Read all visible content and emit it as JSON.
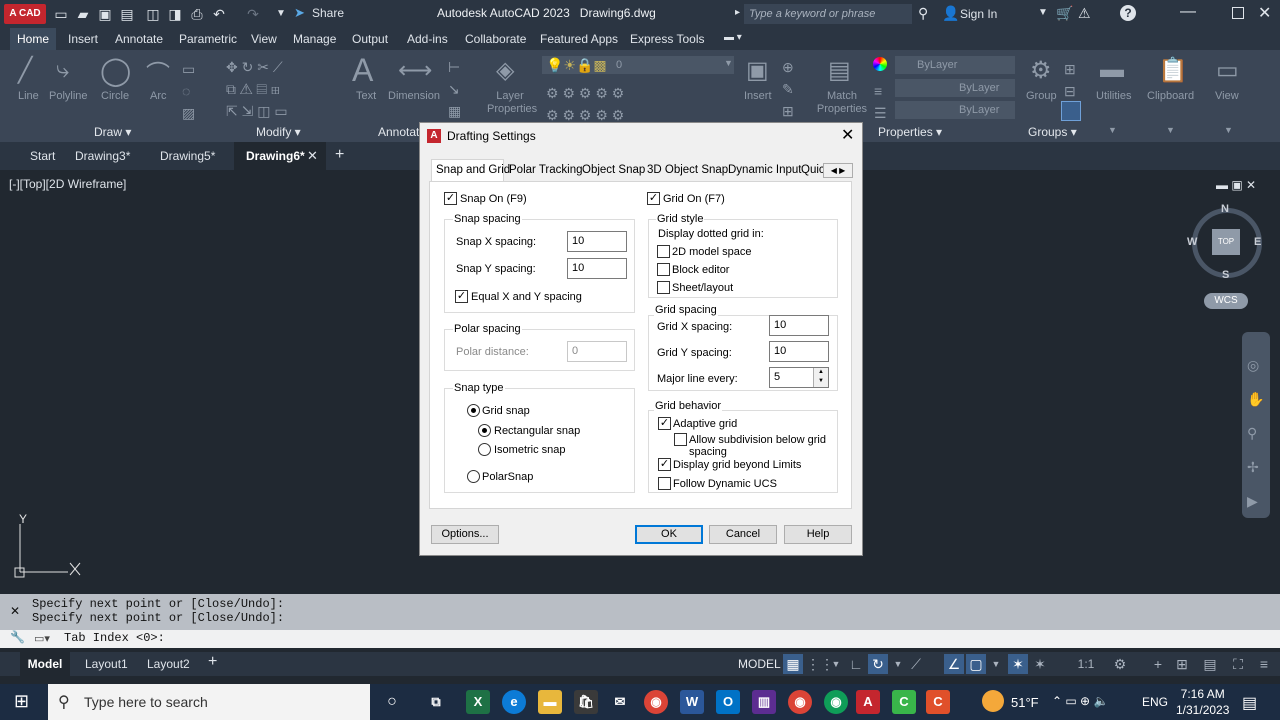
{
  "app": {
    "logo": "A CAD",
    "title": "Autodesk AutoCAD 2023",
    "filename": "Drawing6.dwg",
    "share_label": "Share",
    "search_placeholder": "Type a keyword or phrase",
    "signin_label": "Sign In"
  },
  "ribbon": {
    "tabs": [
      "Home",
      "Insert",
      "Annotate",
      "Parametric",
      "View",
      "Manage",
      "Output",
      "Add-ins",
      "Collaborate",
      "Featured Apps",
      "Express Tools"
    ],
    "draw_tools": [
      "Line",
      "Polyline",
      "Circle",
      "Arc"
    ],
    "text_tools": [
      "Text",
      "Dimension"
    ],
    "layer_props": "Layer Properties",
    "layer_value": "0",
    "insert": "Insert",
    "match_props": "Match Properties",
    "bylayer": [
      "ByLayer",
      "ByLayer",
      "ByLayer"
    ],
    "group": "Group",
    "utilities": "Utilities",
    "clipboard": "Clipboard",
    "view": "View",
    "panels": [
      "Draw",
      "Modify",
      "Annotat",
      "Properties",
      "Groups"
    ]
  },
  "doctabs": [
    "Start",
    "Drawing3*",
    "Drawing5*",
    "Drawing6*"
  ],
  "viewport": {
    "label": "[-][Top][2D Wireframe]",
    "ucs_y": "Y",
    "viewcube": {
      "n": "N",
      "s": "S",
      "e": "E",
      "w": "W",
      "top": "TOP"
    },
    "wcs": "WCS"
  },
  "dialog": {
    "title": "Drafting Settings",
    "tabs": [
      "Snap and Grid",
      "Polar Tracking",
      "Object Snap",
      "3D Object Snap",
      "Dynamic Input",
      "Quic"
    ],
    "snap_on": "Snap On (F9)",
    "snap_spacing": {
      "title": "Snap spacing",
      "x_label": "Snap X spacing:",
      "x_value": "10",
      "y_label": "Snap Y spacing:",
      "y_value": "10",
      "equal": "Equal X and Y spacing"
    },
    "polar_spacing": {
      "title": "Polar spacing",
      "label": "Polar distance:",
      "value": "0"
    },
    "snap_type": {
      "title": "Snap type",
      "grid": "Grid snap",
      "rect": "Rectangular snap",
      "iso": "Isometric snap",
      "polar": "PolarSnap"
    },
    "grid_on": "Grid On (F7)",
    "grid_style": {
      "title": "Grid style",
      "subtitle": "Display dotted grid in:",
      "model": "2D model space",
      "block": "Block editor",
      "sheet": "Sheet/layout"
    },
    "grid_spacing": {
      "title": "Grid spacing",
      "x_label": "Grid X spacing:",
      "x_value": "10",
      "y_label": "Grid Y spacing:",
      "y_value": "10",
      "major_label": "Major line every:",
      "major_value": "5"
    },
    "grid_behavior": {
      "title": "Grid behavior",
      "adaptive": "Adaptive grid",
      "subdiv1": "Allow subdivision below grid",
      "subdiv2": "spacing",
      "beyond": "Display grid beyond Limits",
      "follow": "Follow Dynamic UCS"
    },
    "buttons": {
      "options": "Options...",
      "ok": "OK",
      "cancel": "Cancel",
      "help": "Help"
    }
  },
  "command": {
    "history": [
      "Specify next point or [Close/Undo]:",
      "Specify next point or [Close/Undo]:"
    ],
    "input": "Tab Index <0>:"
  },
  "layouts": [
    "Model",
    "Layout1",
    "Layout2"
  ],
  "status": {
    "model": "MODEL",
    "scale": "1:1"
  },
  "taskbar": {
    "search": "Type here to search",
    "weather": "51°F",
    "lang": "ENG",
    "time": "7:16 AM",
    "date": "1/31/2023"
  }
}
